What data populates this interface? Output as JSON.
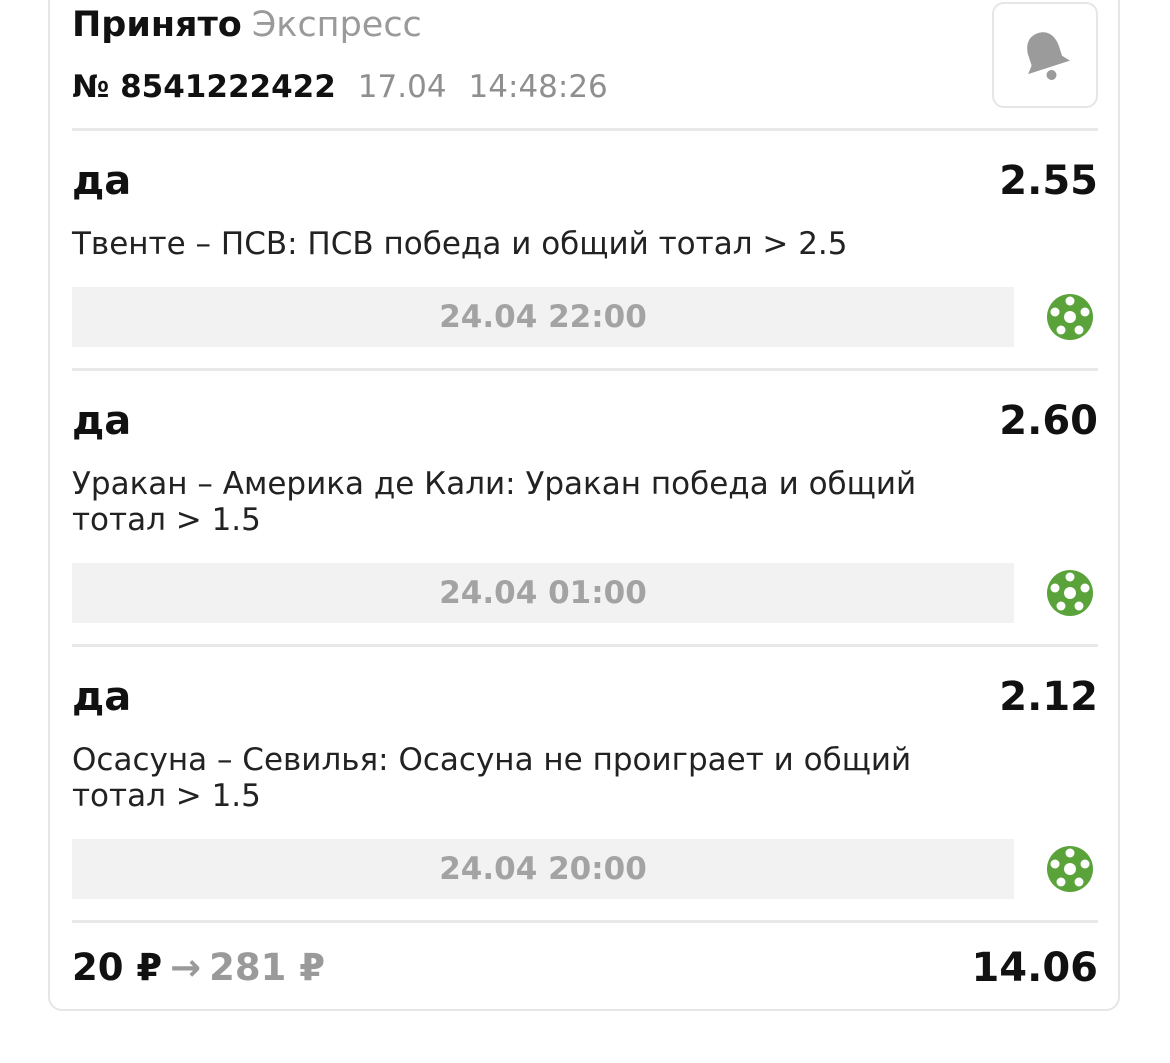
{
  "header": {
    "status": "Принято",
    "bet_type": "Экспресс",
    "number": "№ 8541222422",
    "date": "17.04",
    "time": "14:48:26",
    "bell_icon": "bell-icon"
  },
  "events": [
    {
      "pick": "да",
      "odds": "2.55",
      "description": "Твенте – ПСВ: ПСВ победа и общий тотал > 2.5",
      "start": "24.04 22:00",
      "sport_icon": "football-icon"
    },
    {
      "pick": "да",
      "odds": "2.60",
      "description": "Уракан – Америка де Кали: Уракан победа и общий тотал > 1.5",
      "start": "24.04 01:00",
      "sport_icon": "football-icon"
    },
    {
      "pick": "да",
      "odds": "2.12",
      "description": "Осасуна – Севилья: Осасуна не проиграет и общий тотал > 1.5",
      "start": "24.04 20:00",
      "sport_icon": "football-icon"
    }
  ],
  "footer": {
    "stake": "20 ₽",
    "arrow": "→",
    "payout": "281 ₽",
    "total_odds": "14.06"
  },
  "colors": {
    "sport_icon": "#5aa33a",
    "muted_text": "#9a9a9a",
    "date_bar_bg": "#f2f2f2"
  }
}
